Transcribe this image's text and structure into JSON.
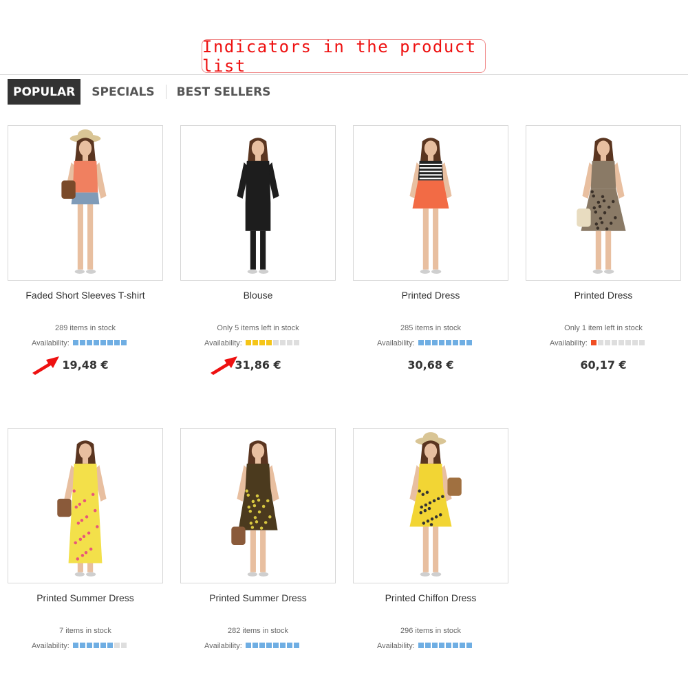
{
  "banner": {
    "title": "Indicators in the product list"
  },
  "tabs": [
    {
      "label": "POPULAR",
      "active": true
    },
    {
      "label": "SPECIALS",
      "active": false
    },
    {
      "label": "BEST SELLERS",
      "active": false
    }
  ],
  "availability_label": "Availability:",
  "colors": {
    "high": "#6faee3",
    "medium": "#f5c518",
    "low": "#f04e23",
    "empty": "#dedede"
  },
  "products": [
    {
      "name": "Faded Short Sleeves T-shirt",
      "stock": "289 items in stock",
      "filled": 8,
      "total": 8,
      "level": "high",
      "price": "19,48 €",
      "outfit": "top-shorts"
    },
    {
      "name": "Blouse",
      "stock": "Only 5 items left in stock",
      "filled": 4,
      "total": 8,
      "level": "medium",
      "price": "31,86 €",
      "outfit": "blouse"
    },
    {
      "name": "Printed Dress",
      "stock": "285 items in stock",
      "filled": 8,
      "total": 8,
      "level": "high",
      "price": "30,68 €",
      "outfit": "stripe-skirt"
    },
    {
      "name": "Printed Dress",
      "stock": "Only 1 item left in stock",
      "filled": 1,
      "total": 8,
      "level": "low",
      "price": "60,17 €",
      "outfit": "print-dress"
    },
    {
      "name": "Printed Summer Dress",
      "stock": "7 items in stock",
      "filled": 6,
      "total": 8,
      "level": "high",
      "price": "",
      "outfit": "maxi-yellow"
    },
    {
      "name": "Printed Summer Dress",
      "stock": "282 items in stock",
      "filled": 8,
      "total": 8,
      "level": "high",
      "price": "",
      "outfit": "dark-dress"
    },
    {
      "name": "Printed Chiffon Dress",
      "stock": "296 items in stock",
      "filled": 8,
      "total": 8,
      "level": "high",
      "price": "",
      "outfit": "yellow-dress"
    }
  ]
}
